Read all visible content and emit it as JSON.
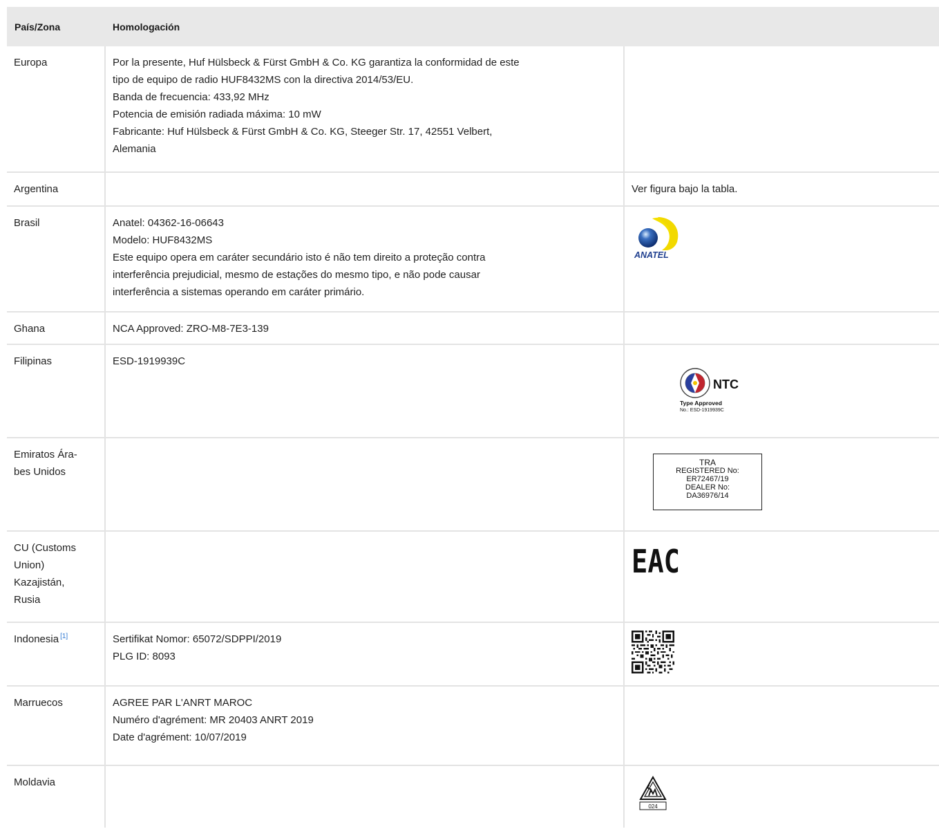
{
  "table": {
    "headers": {
      "country": "País/Zona",
      "approval": "Homologación"
    },
    "rows": [
      {
        "country": "Europa",
        "lines": [
          "Por la presente, Huf Hülsbeck & Fürst GmbH & Co. KG garantiza la conformidad de este",
          "tipo de equipo de radio HUF8432MS con la directiva 2014/53/EU.",
          "Banda de frecuencia: 433,92 MHz",
          "Potencia de emisión radiada máxima: 10 mW",
          "Fabricante: Huf Hülsbeck & Fürst GmbH & Co. KG, Steeger Str. 17, 42551 Velbert,",
          "Alemania"
        ]
      },
      {
        "country": "Argentina",
        "note": "Ver figura bajo la tabla."
      },
      {
        "country": "Brasil",
        "lines": [
          "Anatel: 04362-16-06643",
          "Modelo: HUF8432MS",
          "Este equipo opera em caráter secundário isto é não tem direito a proteção contra",
          "interferência prejudicial, mesmo de estações do mesmo tipo, e não pode causar",
          "interferência a sistemas operando em caráter primário."
        ],
        "logo_text": "ANATEL"
      },
      {
        "country": "Ghana",
        "lines": [
          "NCA Approved: ZRO-M8-7E3-139"
        ]
      },
      {
        "country": "Filipinas",
        "lines": [
          "ESD-1919939C"
        ],
        "logo": {
          "name": "NTC",
          "line1": "Type Approved",
          "line2": "No.: ESD-1919939C",
          "ring": "NATIONAL TELECOMMUNICATIONS COMMISSION"
        }
      },
      {
        "country_lines": [
          "Emiratos Ára-",
          "bes Unidos"
        ],
        "logo": [
          "TRA",
          "REGISTERED No:",
          "ER72467/19",
          "DEALER No:",
          "DA36976/14"
        ]
      },
      {
        "country_lines": [
          "CU (Customs",
          "Union)",
          "Kazajistán,",
          "Rusia"
        ],
        "logo_text": "EAC"
      },
      {
        "country": "Indonesia",
        "footnote": "[1]",
        "lines": [
          "Sertifikat Nomor: 65072/SDPPI/2019",
          "PLG ID: 8093"
        ]
      },
      {
        "country": "Marruecos",
        "lines": [
          "AGREE PAR L'ANRT MAROC",
          "Numéro d'agrément: MR 20403 ANRT 2019",
          "Date d'agrément: 10/07/2019"
        ]
      },
      {
        "country": "Moldavia",
        "logo_text": "024"
      }
    ]
  }
}
